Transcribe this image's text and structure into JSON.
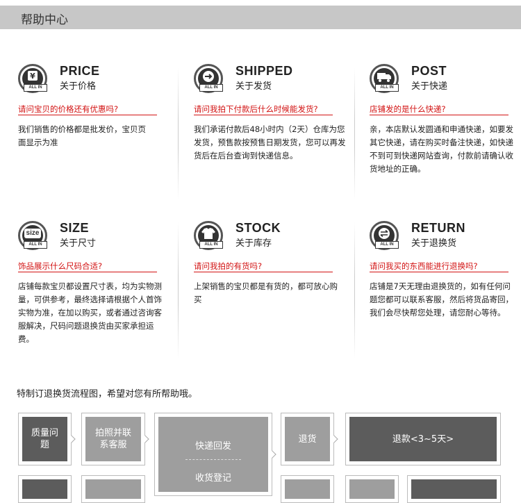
{
  "header": {
    "title": "帮助中心"
  },
  "cards": [
    {
      "icon": "yen-icon",
      "badge": "ALL IN",
      "title_en": "PRICE",
      "title_cn": "关于价格",
      "question": "请问宝贝的价格还有优惠吗?",
      "answer": "我们销售的价格都是批发价，宝贝页面显示为准"
    },
    {
      "icon": "arrow-right-icon",
      "badge": "ALL IN",
      "title_en": "SHIPPED",
      "title_cn": "关于发货",
      "question": "请问我拍下付款后什么时候能发货?",
      "answer": "我们承诺付款后48小时内（2天）仓库为您发货，预售款按预售日期发货，您可以再发货后在后台查询到快递信息。"
    },
    {
      "icon": "truck-icon",
      "badge": "ALL IN",
      "title_en": "POST",
      "title_cn": "关于快递",
      "question": "店铺发的是什么快递?",
      "answer": "亲，本店默认发圆通和申通快递，如要发其它快递，请在购买时备注快递，如快递不到可到快递网站查询，付款前请确认收货地址的正确。"
    },
    {
      "icon": "size-icon",
      "badge": "ALL IN",
      "icon_text": "size",
      "title_en": "SIZE",
      "title_cn": "关于尺寸",
      "question": "饰品展示什么尺码合适?",
      "answer": "店铺每款宝贝都设置尺寸表，均为实物测量，可供参考，最终选择请根据个人首饰实物为准，在加以购买，或者通过咨询客服解决，尺码问题退换货由买家承担运费。"
    },
    {
      "icon": "shirt-icon",
      "badge": "ALL IN",
      "title_en": "STOCK",
      "title_cn": "关于库存",
      "question": "请问我拍的有货吗?",
      "answer": "上架销售的宝贝都是有货的，都可放心购买"
    },
    {
      "icon": "exchange-arrows-icon",
      "badge": "ALL IN",
      "title_en": "RETURN",
      "title_cn": "关于退换货",
      "question": "请问我买的东西能进行退换吗?",
      "answer": "店铺是7天无理由退换货的，如有任何问题您都可以联系客服，然后将货品寄回，我们会尽快帮您处理，请您耐心等待。"
    }
  ],
  "flow": {
    "title": "特制订退换货流程图，希望对您有所帮助哦。",
    "step1": "质量问题",
    "step2": "拍照并联系客服",
    "step3a": "快递回发",
    "step3b": "收货登记",
    "step4": "退货",
    "step5": "退款<3~5天>"
  },
  "colors": {
    "accent_red": "#d21212",
    "header_bg": "#c7c7c7",
    "flow_dark": "#5c5c5c",
    "flow_mid": "#9e9e9e"
  }
}
